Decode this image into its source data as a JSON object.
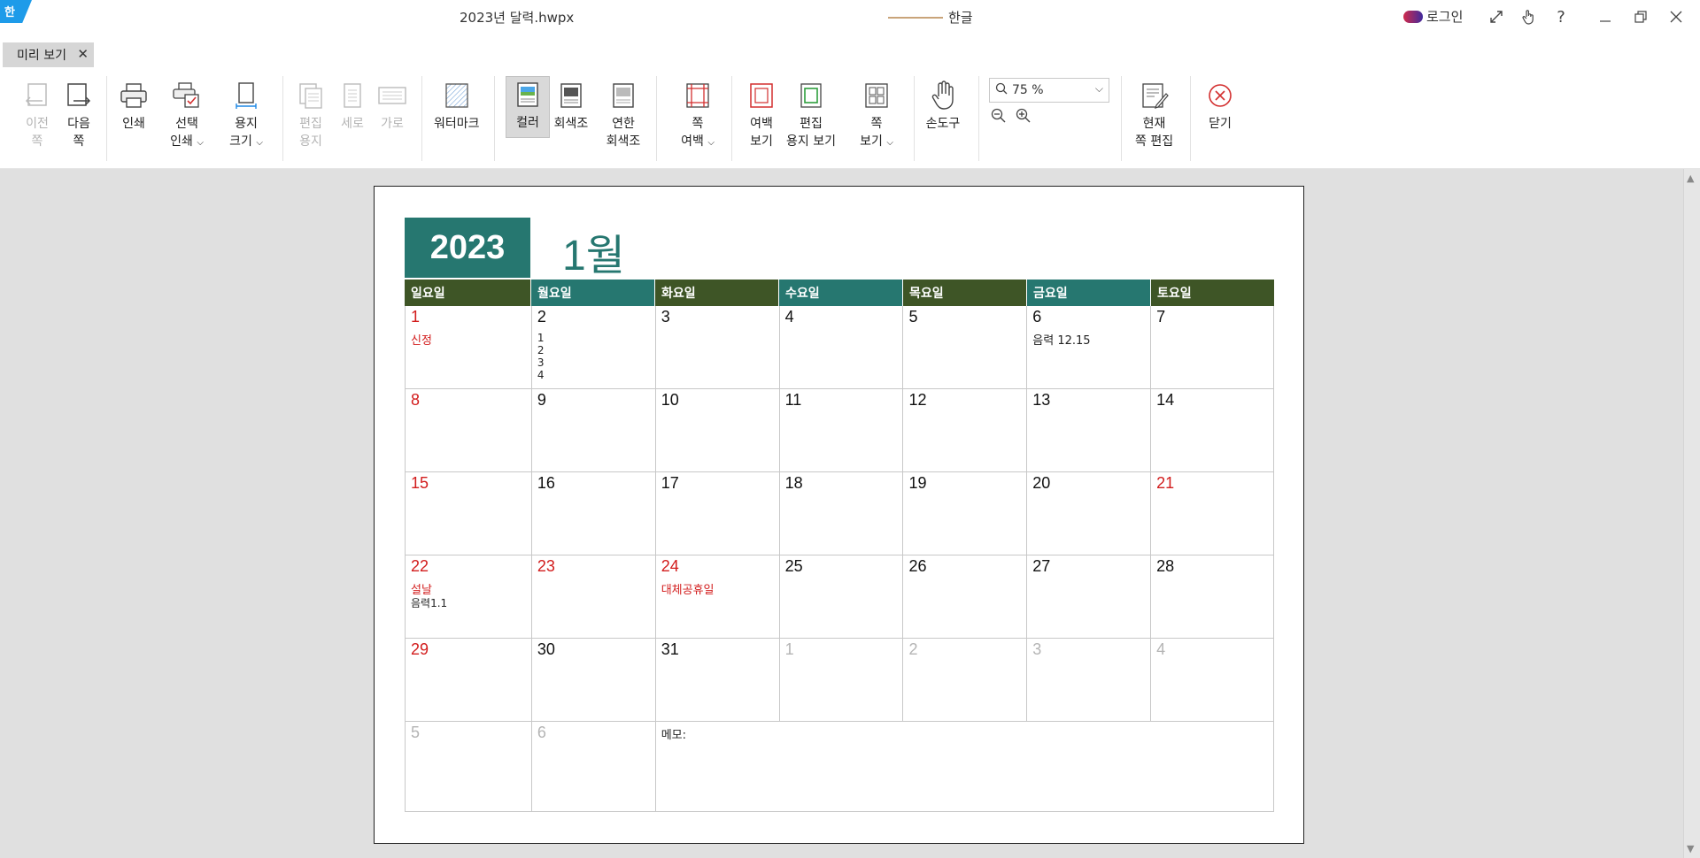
{
  "titlebar": {
    "logo": "한",
    "doc_title": "2023년 달력.hwpx",
    "app_name": "한글",
    "login": "로그인",
    "buttons": [
      "fullscreen-icon",
      "touch-icon",
      "help-icon",
      "minimize-icon",
      "restore-icon",
      "close-icon"
    ]
  },
  "tab": {
    "label": "미리 보기",
    "close": "✕"
  },
  "ribbon": {
    "prev": [
      "이전",
      "쪽"
    ],
    "next": [
      "다음",
      "쪽"
    ],
    "print": "인쇄",
    "select_print": [
      "선택",
      "인쇄"
    ],
    "paper_size": [
      "용지",
      "크기"
    ],
    "edit_paper": [
      "편집",
      "용지"
    ],
    "portrait": "세로",
    "landscape": "가로",
    "watermark": "워터마크",
    "color": "컬러",
    "grayscale": "회색조",
    "light_grayscale": [
      "연한",
      "회색조"
    ],
    "page_margin": [
      "쪽",
      "여백"
    ],
    "margin_view": [
      "여백",
      "보기"
    ],
    "edit_paper_view": [
      "편집",
      "용지 보기"
    ],
    "page_view": [
      "쪽",
      "보기"
    ],
    "hand_tool": "손도구",
    "zoom_value": "75 %",
    "current_page_edit": [
      "현재",
      "쪽 편집"
    ],
    "close": "닫기"
  },
  "calendar": {
    "year": "2023",
    "month": "1월",
    "weekdays": [
      "일요일",
      "월요일",
      "화요일",
      "수요일",
      "목요일",
      "금요일",
      "토요일"
    ],
    "weeks": [
      [
        {
          "day": "1",
          "style": "red",
          "note": "신정"
        },
        {
          "day": "2",
          "style": "",
          "stack": [
            "1",
            "2",
            "3",
            "4"
          ]
        },
        {
          "day": "3",
          "style": ""
        },
        {
          "day": "4",
          "style": ""
        },
        {
          "day": "5",
          "style": ""
        },
        {
          "day": "6",
          "style": "",
          "note_black": "음력  12.15"
        },
        {
          "day": "7",
          "style": ""
        }
      ],
      [
        {
          "day": "8",
          "style": "red"
        },
        {
          "day": "9",
          "style": ""
        },
        {
          "day": "10",
          "style": ""
        },
        {
          "day": "11",
          "style": ""
        },
        {
          "day": "12",
          "style": ""
        },
        {
          "day": "13",
          "style": ""
        },
        {
          "day": "14",
          "style": ""
        }
      ],
      [
        {
          "day": "15",
          "style": "red"
        },
        {
          "day": "16",
          "style": ""
        },
        {
          "day": "17",
          "style": ""
        },
        {
          "day": "18",
          "style": ""
        },
        {
          "day": "19",
          "style": ""
        },
        {
          "day": "20",
          "style": ""
        },
        {
          "day": "21",
          "style": "red"
        }
      ],
      [
        {
          "day": "22",
          "style": "red",
          "note": "설날",
          "note_small": "음력1.1"
        },
        {
          "day": "23",
          "style": "red"
        },
        {
          "day": "24",
          "style": "red",
          "note": "대체공휴일"
        },
        {
          "day": "25",
          "style": ""
        },
        {
          "day": "26",
          "style": ""
        },
        {
          "day": "27",
          "style": ""
        },
        {
          "day": "28",
          "style": ""
        }
      ],
      [
        {
          "day": "29",
          "style": "red"
        },
        {
          "day": "30",
          "style": ""
        },
        {
          "day": "31",
          "style": ""
        },
        {
          "day": "1",
          "style": "gray"
        },
        {
          "day": "2",
          "style": "gray"
        },
        {
          "day": "3",
          "style": "gray"
        },
        {
          "day": "4",
          "style": "gray"
        }
      ]
    ],
    "last_row": {
      "days": [
        "5",
        "6"
      ],
      "memo_label": "메모:"
    }
  },
  "colors": {
    "teal": "#267770",
    "olive": "#3e5526",
    "holiday_red": "#d21c1c",
    "workspace_gray": "#e0e0e0"
  }
}
